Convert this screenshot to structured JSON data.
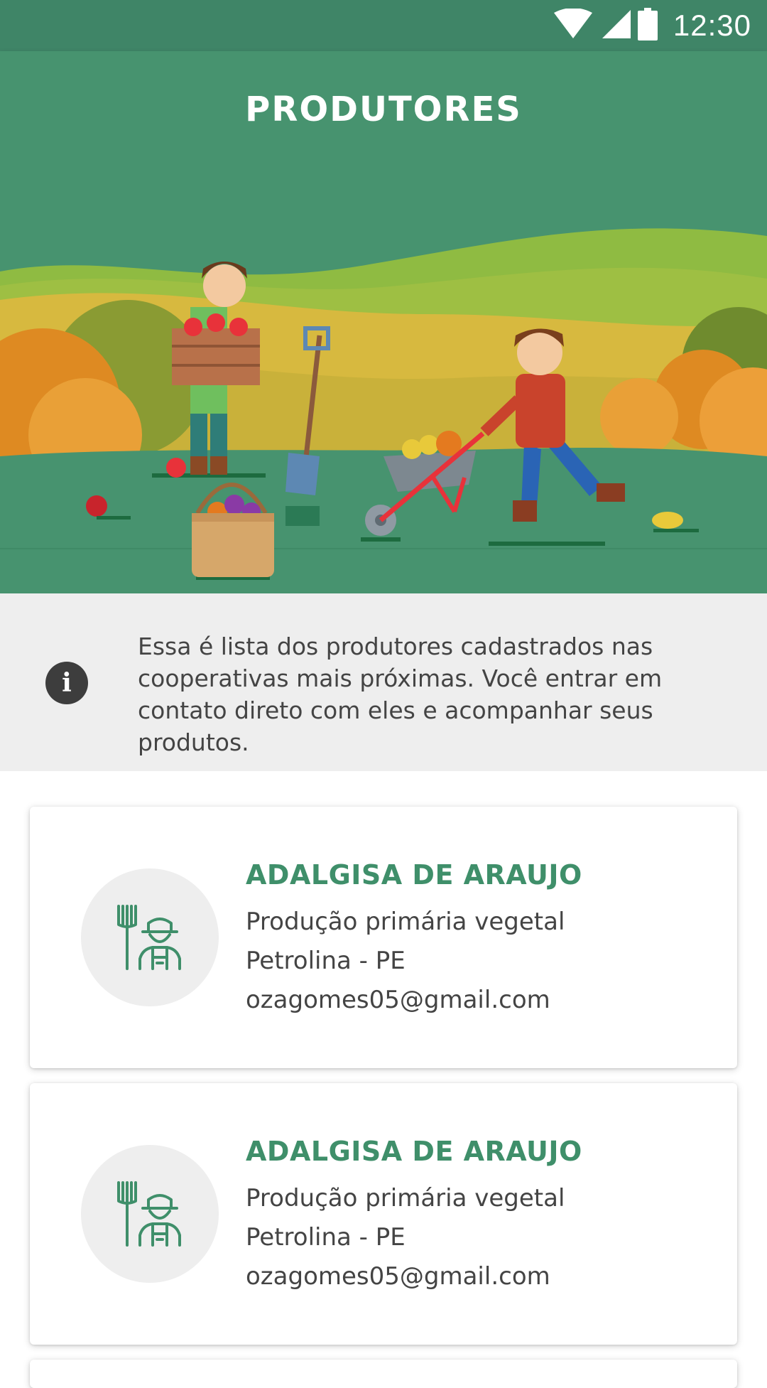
{
  "status_bar": {
    "time": "12:30",
    "icons": [
      "wifi-icon",
      "cell-signal-icon",
      "battery-icon"
    ]
  },
  "header": {
    "title": "PRODUTORES",
    "background_color": "#47936f"
  },
  "info": {
    "icon": "info-icon",
    "text": "Essa é lista dos produtores cadastrados nas cooperativas mais próximas. Você entrar em contato direto com eles e acompanhar seus produtos."
  },
  "producers": [
    {
      "name": "ADALGISA DE ARAUJO",
      "activity": "Produção primária vegetal",
      "location": "Petrolina - PE",
      "email": "ozagomes05@gmail.com",
      "icon": "farmer-pitchfork-icon"
    },
    {
      "name": "ADALGISA DE ARAUJO",
      "activity": "Produção primária vegetal",
      "location": "Petrolina - PE",
      "email": "ozagomes05@gmail.com",
      "icon": "farmer-pitchfork-icon"
    }
  ],
  "colors": {
    "accent": "#3f8f6a",
    "status_bar": "#3f8567"
  }
}
